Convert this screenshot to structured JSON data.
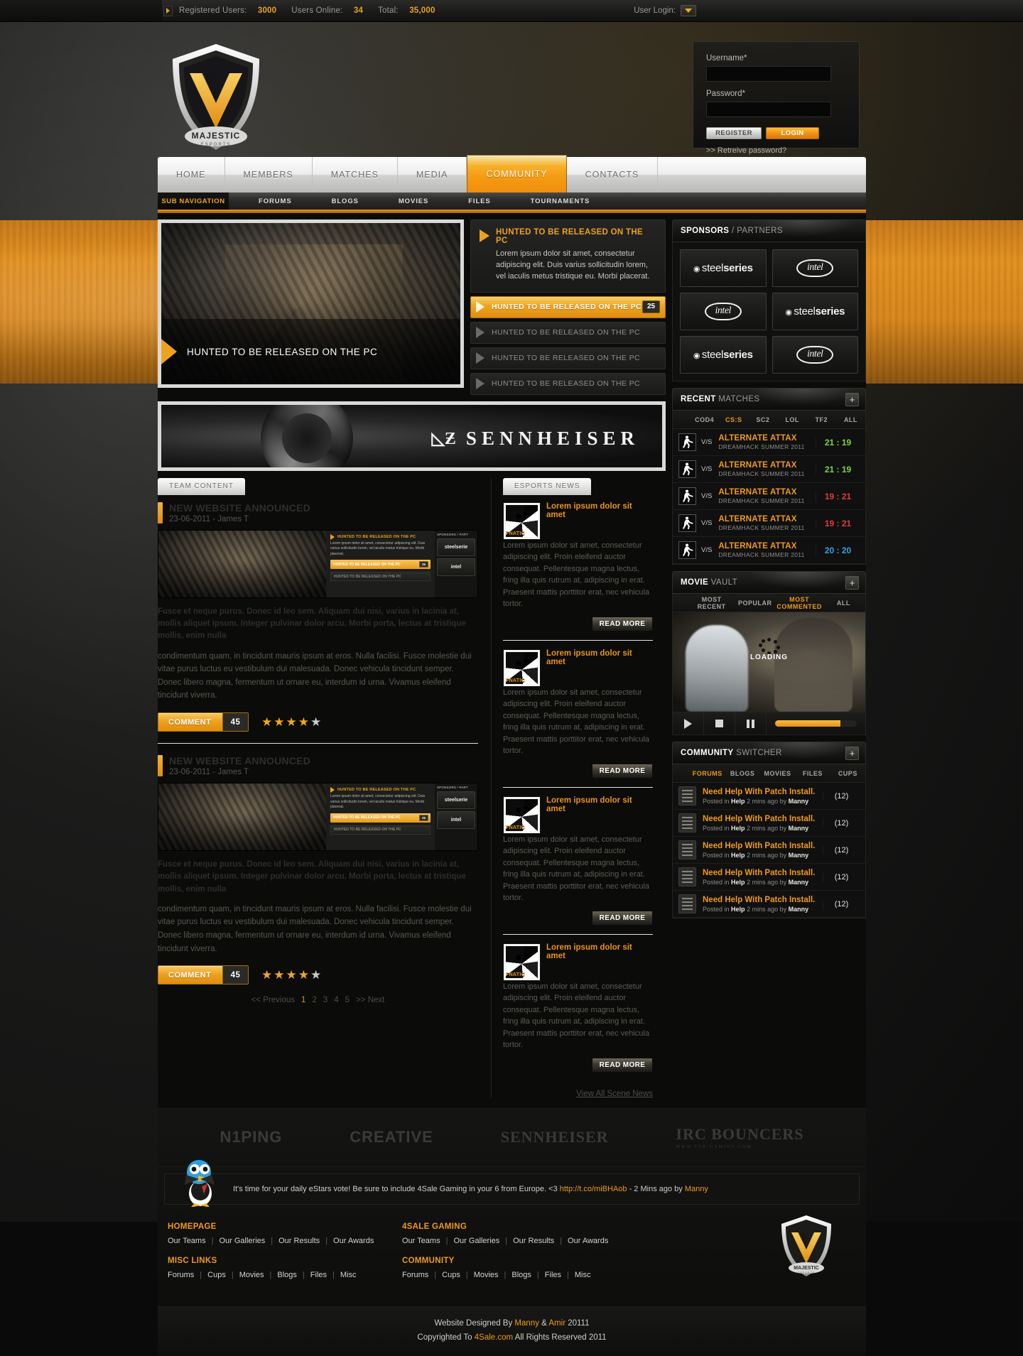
{
  "topbar": {
    "registered_label": "Registered Users:",
    "registered_value": "3000",
    "online_label": "Users Online:",
    "online_value": "34",
    "total_label": "Total:",
    "total_value": "35,000",
    "user_login_label": "User Login:"
  },
  "login": {
    "username_label": "Username*",
    "password_label": "Password*",
    "username_value": "",
    "password_value": "",
    "register_label": "REGISTER",
    "login_label": "LOGIN",
    "retrieve_label": ">> Retreive password?"
  },
  "brand": {
    "name": "MAJESTIC",
    "sub": "ESPORTS"
  },
  "nav": {
    "items": [
      {
        "label": "HOME",
        "active": false
      },
      {
        "label": "MEMBERS",
        "active": false
      },
      {
        "label": "MATCHES",
        "active": false
      },
      {
        "label": "MEDIA",
        "active": false
      },
      {
        "label": "COMMUNITY",
        "active": true
      },
      {
        "label": "CONTACTS",
        "active": false
      }
    ]
  },
  "subnav": {
    "title": "SUB NAVIGATION",
    "items": [
      "FORUMS",
      "BLOGS",
      "MOVIES",
      "FILES",
      "TOURNAMENTS"
    ]
  },
  "slider": {
    "caption": "HUNTED TO BE RELEASED ON THE PC",
    "featured_title": "HUNTED TO BE RELEASED ON THE PC",
    "featured_text": "Lorem ipsum dolor sit amet, consectetur adipiscing elit. Duis varius sollicitudin lorem, vel iaculis metus tristique eu. Morbi placerat.",
    "items": [
      {
        "label": "HUNTED TO BE RELEASED ON THE PC",
        "badge": "25",
        "active": true
      },
      {
        "label": "HUNTED TO BE RELEASED ON THE PC",
        "badge": "",
        "active": false
      },
      {
        "label": "HUNTED TO BE RELEASED ON THE PC",
        "badge": "",
        "active": false
      },
      {
        "label": "HUNTED TO BE RELEASED ON THE PC",
        "badge": "",
        "active": false
      }
    ]
  },
  "banner": {
    "brand": "SENNHEISER",
    "mark": "◺Ƶ"
  },
  "articles": {
    "tab_label": "TEAM CONTENT",
    "items": [
      {
        "title": "NEW WEBSITE ANNOUNCED",
        "meta": "23-06-2011 - James T",
        "lead": "Fusce et neque purus. Donec id leo sem. Aliquam dui nisi, varius in lacinia at, mollis aliquet ipsum. Integer pulvinar dolor arcu. Morbi porta, lectus at tristique mollis, enim nulla",
        "body": "condimentum quam, in tincidunt mauris ipsum at eros. Nulla facilisi. Fusce molestie dui vitae purus luctus eu vestibulum dui malesuada. Donec vehicula tincidunt semper. Donec libero magna, fermentum ut ornare eu, interdum id urna. Vivamus eleifend tincidunt viverra.",
        "comment_label": "COMMENT",
        "comment_count": "45",
        "rating": 4
      },
      {
        "title": "NEW WEBSITE ANNOUNCED",
        "meta": "23-06-2011 - James T",
        "lead": "Fusce et neque purus. Donec id leo sem. Aliquam dui nisi, varius in lacinia at, mollis aliquet ipsum. Integer pulvinar dolor arcu. Morbi porta, lectus at tristique mollis, enim nulla",
        "body": "condimentum quam, in tincidunt mauris ipsum at eros. Nulla facilisi. Fusce molestie dui vitae purus luctus eu vestibulum dui malesuada. Donec vehicula tincidunt semper. Donec libero magna, fermentum ut ornare eu, interdum id urna. Vivamus eleifend tincidunt viverra.",
        "comment_label": "COMMENT",
        "comment_count": "45",
        "rating": 4
      }
    ],
    "thumb_inner": {
      "headline": "HUNTED TO BE RELEASED ON THE PC",
      "text": "Lorem ipsum dolor sit amet, consectetur adipiscing elit. Duis varius sollicitudin lorem, vel iaculis metus tristique eu. Morbi placerat.",
      "bar_active": "HUNTED TO BE RELEASED ON THE PC",
      "bar_badge": "25",
      "bar_dim": "HUNTED TO BE RELEASED ON THE PC",
      "sponsor_title": "SPONSORS / PART",
      "sponsor1": "steelserie",
      "sponsor2": "intel"
    },
    "pager": {
      "prev": "<< Previous",
      "pages": [
        "1",
        "2",
        "3",
        "4",
        "5"
      ],
      "current": "1",
      "next": ">> Next"
    }
  },
  "news": {
    "tab_label": "ESPORTS NEWS",
    "thumb_tag": "FNATIC",
    "read_more": "READ MORE",
    "view_all": "View All Scene News",
    "items": [
      {
        "title": "Lorem ipsum dolor sit amet",
        "text": "Lorem ipsum dolor sit amet, consectetur adipiscing elit. Proin eleifend auctor consequat. Pellentesque magna lectus, fring illa quis rutrum at, adipiscing in erat. Praesent mattis porttitor erat, nec vehicula tortor."
      },
      {
        "title": "Lorem ipsum dolor sit amet",
        "text": "Lorem ipsum dolor sit amet, consectetur adipiscing elit. Proin eleifend auctor consequat. Pellentesque magna lectus, fring illa quis rutrum at, adipiscing in erat. Praesent mattis porttitor erat, nec vehicula tortor."
      },
      {
        "title": "Lorem ipsum dolor sit amet",
        "text": "Lorem ipsum dolor sit amet, consectetur adipiscing elit. Proin eleifend auctor consequat. Pellentesque magna lectus, fring illa quis rutrum at, adipiscing in erat. Praesent mattis porttitor erat, nec vehicula tortor."
      },
      {
        "title": "Lorem ipsum dolor sit amet",
        "text": "Lorem ipsum dolor sit amet, consectetur adipiscing elit. Proin eleifend auctor consequat. Pellentesque magna lectus, fring illa quis rutrum at, adipiscing in erat. Praesent mattis porttitor erat, nec vehicula tortor."
      }
    ]
  },
  "sponsors_panel": {
    "title_bold": "SPONSORS",
    "title_light": "/ PARTNERS",
    "logos": [
      "steelseries",
      "intel",
      "intel",
      "steelseries",
      "steelseries",
      "intel"
    ]
  },
  "matches_panel": {
    "title_bold": "RECENT",
    "title_light": "MATCHES",
    "plus": "+",
    "tabs": [
      {
        "label": "COD4",
        "active": false
      },
      {
        "label": "CS:S",
        "active": true
      },
      {
        "label": "SC2",
        "active": false
      },
      {
        "label": "LOL",
        "active": false
      },
      {
        "label": "TF2",
        "active": false
      },
      {
        "label": "ALL",
        "active": false
      }
    ],
    "vs_label": "V/S",
    "rows": [
      {
        "team": "ALTERNATE ATTAX",
        "event": "DREAMHACK SUMMER 2011",
        "score": "21 : 19",
        "result": "win"
      },
      {
        "team": "ALTERNATE ATTAX",
        "event": "DREAMHACK SUMMER 2011",
        "score": "21 : 19",
        "result": "win"
      },
      {
        "team": "ALTERNATE ATTAX",
        "event": "DREAMHACK SUMMER 2011",
        "score": "19 : 21",
        "result": "lose"
      },
      {
        "team": "ALTERNATE ATTAX",
        "event": "DREAMHACK SUMMER 2011",
        "score": "19 : 21",
        "result": "lose"
      },
      {
        "team": "ALTERNATE ATTAX",
        "event": "DREAMHACK SUMMER 2011",
        "score": "20 : 20",
        "result": "draw"
      }
    ]
  },
  "movie_panel": {
    "title_bold": "MOVIE",
    "title_light": "VAULT",
    "plus": "+",
    "tabs": [
      {
        "label": "MOST RECENT",
        "active": false
      },
      {
        "label": "POPULAR",
        "active": false
      },
      {
        "label": "MOST COMMENTED",
        "active": true
      },
      {
        "label": "ALL",
        "active": false
      }
    ],
    "loading_label": "LOADING",
    "progress_percent": 80
  },
  "community_panel": {
    "title_bold": "COMMUNITY",
    "title_light": "SWITCHER",
    "plus": "+",
    "tabs": [
      {
        "label": "FORUMS",
        "active": true
      },
      {
        "label": "BLOGS",
        "active": false
      },
      {
        "label": "MOVIES",
        "active": false
      },
      {
        "label": "FILES",
        "active": false
      },
      {
        "label": "CUPS",
        "active": false
      }
    ],
    "rows": [
      {
        "title": "Need Help With Patch Install.",
        "posted_in": "Posted in",
        "forum": "Help",
        "time": "2 mins ago by",
        "author": "Manny",
        "count": "(12)"
      },
      {
        "title": "Need Help With Patch Install.",
        "posted_in": "Posted in",
        "forum": "Help",
        "time": "2 mins ago by",
        "author": "Manny",
        "count": "(12)"
      },
      {
        "title": "Need Help With Patch Install.",
        "posted_in": "Posted in",
        "forum": "Help",
        "time": "2 mins ago by",
        "author": "Manny",
        "count": "(12)"
      },
      {
        "title": "Need Help With Patch Install.",
        "posted_in": "Posted in",
        "forum": "Help",
        "time": "2 mins ago by",
        "author": "Manny",
        "count": "(12)"
      },
      {
        "title": "Need Help With Patch Install.",
        "posted_in": "Posted in",
        "forum": "Help",
        "time": "2 mins ago by",
        "author": "Manny",
        "count": "(12)"
      }
    ]
  },
  "footer": {
    "sponsors": [
      {
        "name": "N1PING",
        "sub": ""
      },
      {
        "name": "CREATIVE",
        "sub": ""
      },
      {
        "name": "SENNHEISER",
        "sub": ""
      },
      {
        "name": "IRC BOUNCERS",
        "sub": "WWW.TAR-GAMING.COM"
      }
    ],
    "tweet_text": "It's time for your daily eStars vote! Be sure to include 4Sale Gaming in your 6 from Europe. <3 ",
    "tweet_link": "http://t.co/miBHAob",
    "tweet_tail": " - 2 Mins ago by ",
    "tweet_author": "Manny",
    "columns": [
      {
        "blocks": [
          {
            "heading": "4SALE GAMING",
            "links": [
              "Our Teams",
              "Our Galleries",
              "Our Results",
              "Our Awards"
            ]
          },
          {
            "heading": "COMMUNITY",
            "links": [
              "Forums",
              "Cups",
              "Movies",
              "Blogs",
              "Files",
              "Misc"
            ]
          }
        ]
      },
      {
        "blocks": [
          {
            "heading": "HOMEPAGE",
            "links": [
              "Our Teams",
              "Our Galleries",
              "Our Results",
              "Our Awards"
            ]
          },
          {
            "heading": "MISC LINKS",
            "links": [
              "Forums",
              "Cups",
              "Movies",
              "Blogs",
              "Files",
              "Misc"
            ]
          }
        ]
      }
    ],
    "designed_prefix": "Website Designed By ",
    "designer1": "Manny",
    "designed_amp": " & ",
    "designer2": "Amir",
    "designed_year": " 20111",
    "copy_prefix": "Copyrighted To ",
    "copy_site": "4Sale.com",
    "copy_suffix": " All Rights Reserved 2011"
  },
  "colors": {
    "accent": "#ef9a1c",
    "win": "#7ad63a",
    "lose": "#e23b3b",
    "draw": "#3aa0e2"
  }
}
